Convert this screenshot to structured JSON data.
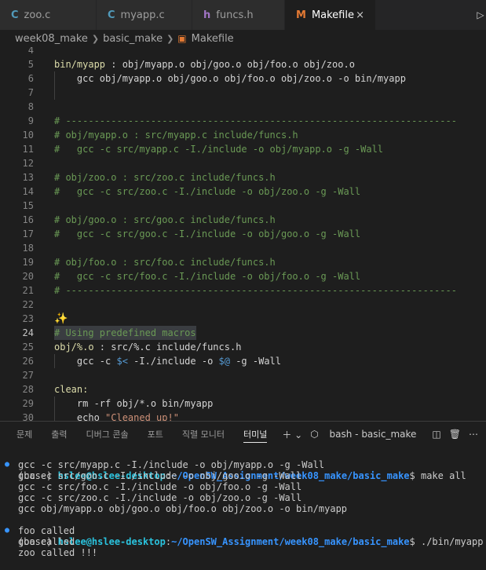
{
  "tabs": [
    {
      "label": "zoo.c",
      "icon": "C"
    },
    {
      "label": "myapp.c",
      "icon": "C"
    },
    {
      "label": "funcs.h",
      "icon": "h"
    },
    {
      "label": "Makefile",
      "icon": "M",
      "close": "×"
    }
  ],
  "breadcrumb": [
    "week08_make",
    "basic_make",
    "Makefile"
  ],
  "editor": {
    "line_numbers": [
      "4",
      "5",
      "6",
      "7",
      "8",
      "9",
      "10",
      "11",
      "12",
      "13",
      "14",
      "15",
      "16",
      "17",
      "18",
      "19",
      "20",
      "21",
      "22",
      "23",
      "24",
      "25",
      "26",
      "27",
      "28",
      "29",
      "30"
    ],
    "l5_target": "bin/myapp",
    "l5_rest": " : obj/myapp.o obj/goo.o obj/foo.o obj/zoo.o",
    "l6": "    gcc obj/myapp.o obj/goo.o obj/foo.o obj/zoo.o -o bin/myapp",
    "l9": "# ---------------------------------------------------------------------",
    "l10": "# obj/myapp.o : src/myapp.c include/funcs.h",
    "l11": "#   gcc -c src/myapp.c -I./include -o obj/myapp.o -g -Wall",
    "l13": "# obj/zoo.o : src/zoo.c include/funcs.h",
    "l14": "#   gcc -c src/zoo.c -I./include -o obj/zoo.o -g -Wall",
    "l16": "# obj/goo.o : src/goo.c include/funcs.h",
    "l17": "#   gcc -c src/goo.c -I./include -o obj/goo.o -g -Wall",
    "l19": "# obj/foo.o : src/foo.c include/funcs.h",
    "l20": "#   gcc -c src/foo.c -I./include -o obj/foo.o -g -Wall",
    "l21": "# ---------------------------------------------------------------------",
    "l23": "✨",
    "l24": "# Using predefined macros",
    "l25_target": "obj/%.o",
    "l25_rest": " : src/%.c include/funcs.h",
    "l26_a": "    gcc -c ",
    "l26_v1": "$<",
    "l26_b": " -I./include -o ",
    "l26_v2": "$@",
    "l26_c": " -g -Wall",
    "l28": "clean:",
    "l29": "    rm -rf obj/*.o bin/myapp",
    "l30_a": "    echo ",
    "l30_s": "\"Cleaned up!\""
  },
  "panel": {
    "tabs": [
      "문제",
      "출력",
      "디버그 콘솔",
      "포트",
      "직렬 모니터",
      "터미널"
    ],
    "active_tab": "터미널",
    "terminal_name": "bash - basic_make"
  },
  "terminal": {
    "prompt_base": "(base) ",
    "user": "hslee@hslee-desktop",
    "path": "~/OpenSW_Assignment/week08_make/basic_make",
    "cmd1": "$ make all",
    "out1": [
      "gcc -c src/myapp.c -I./include -o obj/myapp.o -g -Wall",
      "gcc -c src/goo.c -I./include -o obj/goo.o -g -Wall",
      "gcc -c src/foo.c -I./include -o obj/foo.o -g -Wall",
      "gcc -c src/zoo.c -I./include -o obj/zoo.o -g -Wall",
      "gcc obj/myapp.o obj/goo.o obj/foo.o obj/zoo.o -o bin/myapp"
    ],
    "cmd2": "$ ./bin/myapp",
    "out2": [
      "foo called",
      "goo called",
      "zoo called !!!"
    ],
    "cmd3": "$ "
  }
}
